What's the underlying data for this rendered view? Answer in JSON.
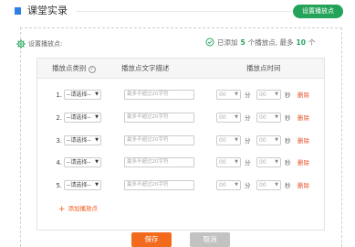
{
  "header": {
    "title": "课堂实录",
    "set_button": "设置播放点",
    "accent": "#2d7fe3",
    "green": "#23a35a"
  },
  "setup": {
    "label": "设置播放点:",
    "counter_prefix": "已添加",
    "added_count": "5",
    "counter_mid": "个播放点, 最多",
    "max_count": "10",
    "counter_suffix": "个"
  },
  "table": {
    "headers": {
      "type": "播放点类别",
      "desc": "播放点文字描述",
      "time": "播放点时间"
    },
    "rows": [
      {
        "index": "1.",
        "type": "--请选择--",
        "desc_placeholder": "最多不超过20字符",
        "minute": "00",
        "second": "00",
        "min_unit": "分",
        "sec_unit": "秒",
        "delete": "删除"
      },
      {
        "index": "2.",
        "type": "--请选择--",
        "desc_placeholder": "最多不超过20字符",
        "minute": "00",
        "second": "00",
        "min_unit": "分",
        "sec_unit": "秒",
        "delete": "删除"
      },
      {
        "index": "3.",
        "type": "--请选择--",
        "desc_placeholder": "最多不超过20字符",
        "minute": "00",
        "second": "00",
        "min_unit": "分",
        "sec_unit": "秒",
        "delete": "删除"
      },
      {
        "index": "4.",
        "type": "--请选择--",
        "desc_placeholder": "最多不超过20字符",
        "minute": "00",
        "second": "00",
        "min_unit": "分",
        "sec_unit": "秒",
        "delete": "删除"
      },
      {
        "index": "5.",
        "type": "--请选择--",
        "desc_placeholder": "最多不超过20字符",
        "minute": "00",
        "second": "00",
        "min_unit": "分",
        "sec_unit": "秒",
        "delete": "删除"
      }
    ],
    "add_label": "添加播放点"
  },
  "footer": {
    "save": "保存",
    "cancel": "取消"
  },
  "icons": {
    "gear": "gear-icon",
    "check": "check-circle-icon",
    "help": "help-icon",
    "plus": "plus-icon",
    "dropdown": "chevron-down-icon"
  }
}
